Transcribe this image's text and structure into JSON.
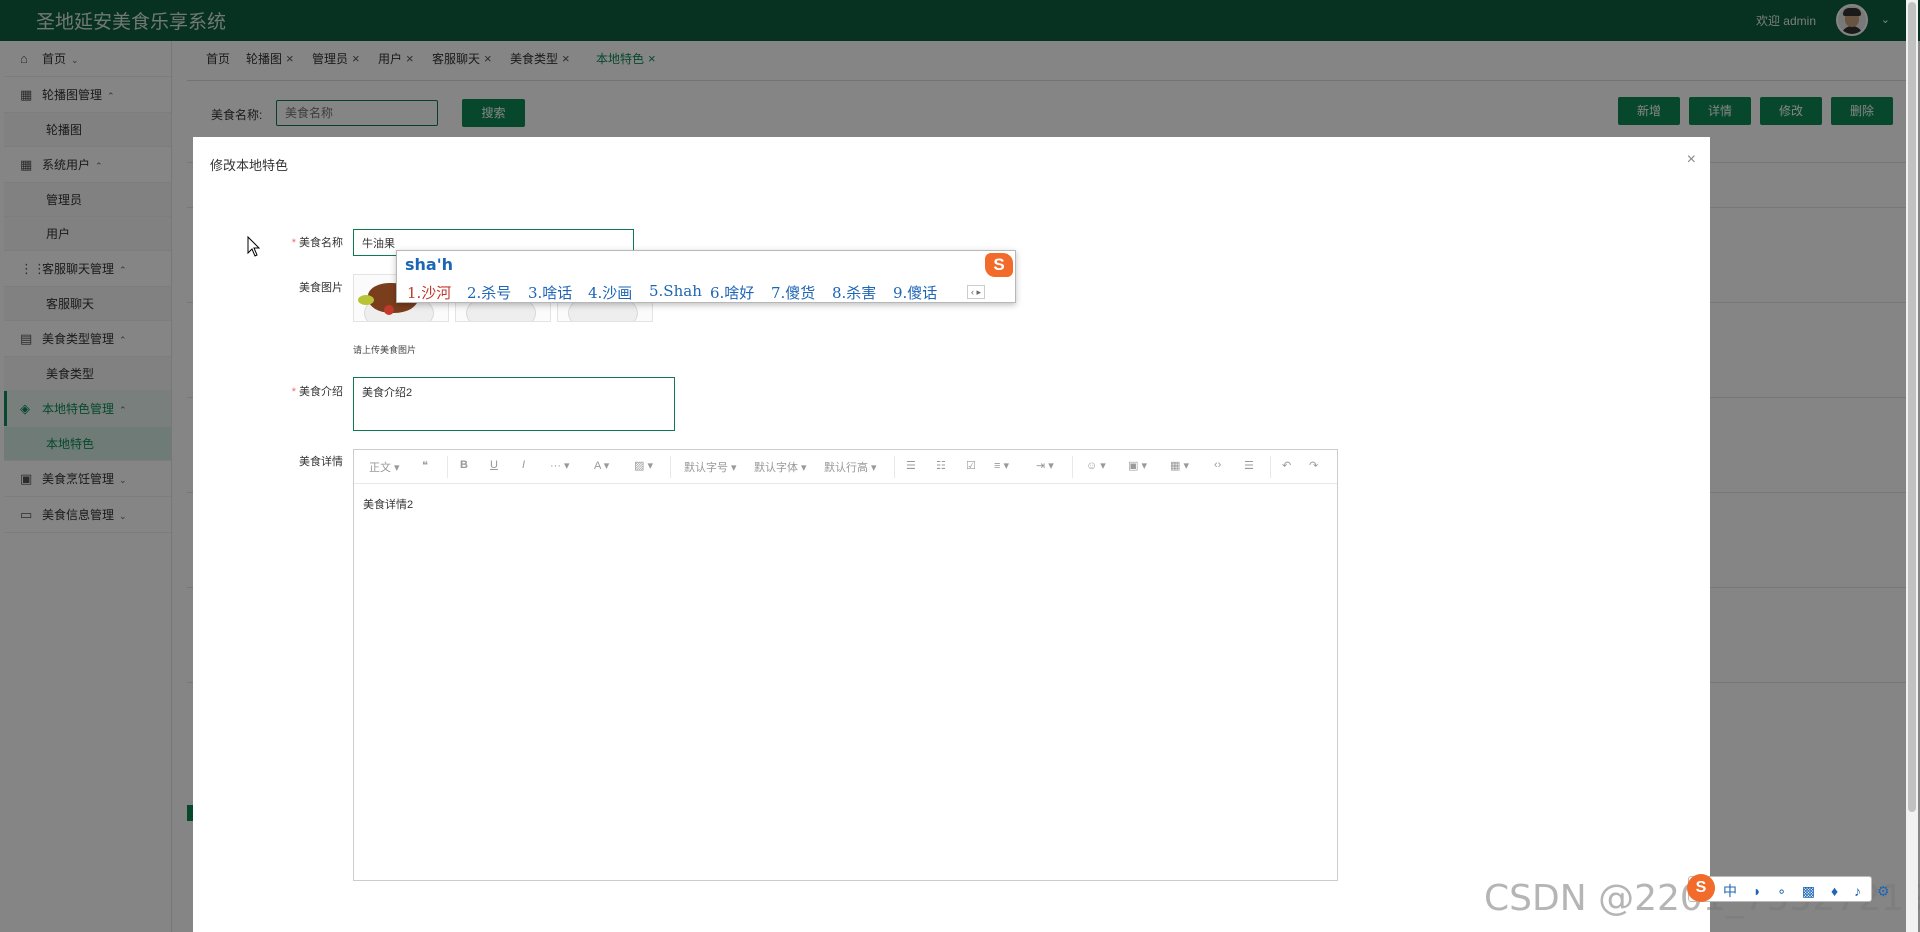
{
  "header": {
    "title": "圣地延安美食乐享系统",
    "welcome": "欢迎 admin",
    "chevron": "⌄"
  },
  "sidebar": {
    "items": [
      {
        "icon": "⌂",
        "label": "首页",
        "arrow": "⌄"
      },
      {
        "icon": "▦",
        "label": "轮播图管理",
        "arrow": "⌃"
      },
      {
        "sub": "轮播图"
      },
      {
        "icon": "▦",
        "label": "系统用户",
        "arrow": "⌃"
      },
      {
        "sub": "管理员"
      },
      {
        "sub": "用户"
      },
      {
        "icon": "⋮⋮",
        "label": "客服聊天管理",
        "arrow": "⌃"
      },
      {
        "sub": "客服聊天"
      },
      {
        "icon": "▤",
        "label": "美食类型管理",
        "arrow": "⌃"
      },
      {
        "sub": "美食类型"
      },
      {
        "icon": "◈",
        "label": "本地特色管理",
        "arrow": "⌃"
      },
      {
        "sub": "本地特色"
      },
      {
        "icon": "▣",
        "label": "美食烹饪管理",
        "arrow": "⌄"
      },
      {
        "icon": "▭",
        "label": "美食信息管理",
        "arrow": "⌄"
      }
    ]
  },
  "tabs": [
    {
      "label": "首页",
      "closable": false
    },
    {
      "label": "轮播图",
      "closable": true
    },
    {
      "label": "管理员",
      "closable": true
    },
    {
      "label": "用户",
      "closable": true
    },
    {
      "label": "客服聊天",
      "closable": true
    },
    {
      "label": "美食类型",
      "closable": true
    },
    {
      "label": "本地特色",
      "closable": true,
      "active": true
    }
  ],
  "search": {
    "label": "美食名称:",
    "placeholder": "美食名称",
    "button": "搜索"
  },
  "actions": {
    "add": "新增",
    "detail": "详情",
    "edit": "修改",
    "delete": "删除"
  },
  "modal": {
    "title": "修改本地特色",
    "close": "×",
    "name_label": "美食名称",
    "name_value": "牛油果",
    "image_label": "美食图片",
    "image_hint": "请上传美食图片",
    "intro_label": "美食介绍",
    "intro_value": "美食介绍2",
    "detail_label": "美食详情",
    "detail_value": "美食详情2"
  },
  "editor_toolbar": {
    "paragraph": "正文 ▾",
    "quote": "❝",
    "bold": "B",
    "underline": "U",
    "italic": "I",
    "more": "··· ▾",
    "font_color": "A ▾",
    "bg_color": "▨ ▾",
    "font_size": "默认字号 ▾",
    "font_family": "默认字体 ▾",
    "line_height": "默认行高 ▾",
    "bullet_list": "☰",
    "number_list": "☷",
    "todo": "☑",
    "align": "≡ ▾",
    "indent": "⇥ ▾",
    "emoji": "☺ ▾",
    "image": "▣ ▾",
    "table": "▦ ▾",
    "code": "‹›",
    "divider": "☰",
    "undo": "↶",
    "redo": "↷"
  },
  "ime": {
    "composition": "sha'h",
    "candidates": [
      "1.沙河",
      "2.杀号",
      "3.啥话",
      "4.沙画",
      "5.Shah",
      "6.啥好",
      "7.傻货",
      "8.杀害",
      "9.傻话"
    ],
    "logo": "S",
    "pager": "‹ ▸"
  },
  "watermark": "CSDN @2201_75527219",
  "tray": {
    "logo": "S",
    "items": "中 ◗ ∘ ▩ ♦ ♪ ⚙"
  },
  "colors": {
    "brand": "#0f5e3f",
    "accent": "#0e8a57",
    "ime_blue": "#1d65b5",
    "ime_orange": "#f26b2a"
  }
}
